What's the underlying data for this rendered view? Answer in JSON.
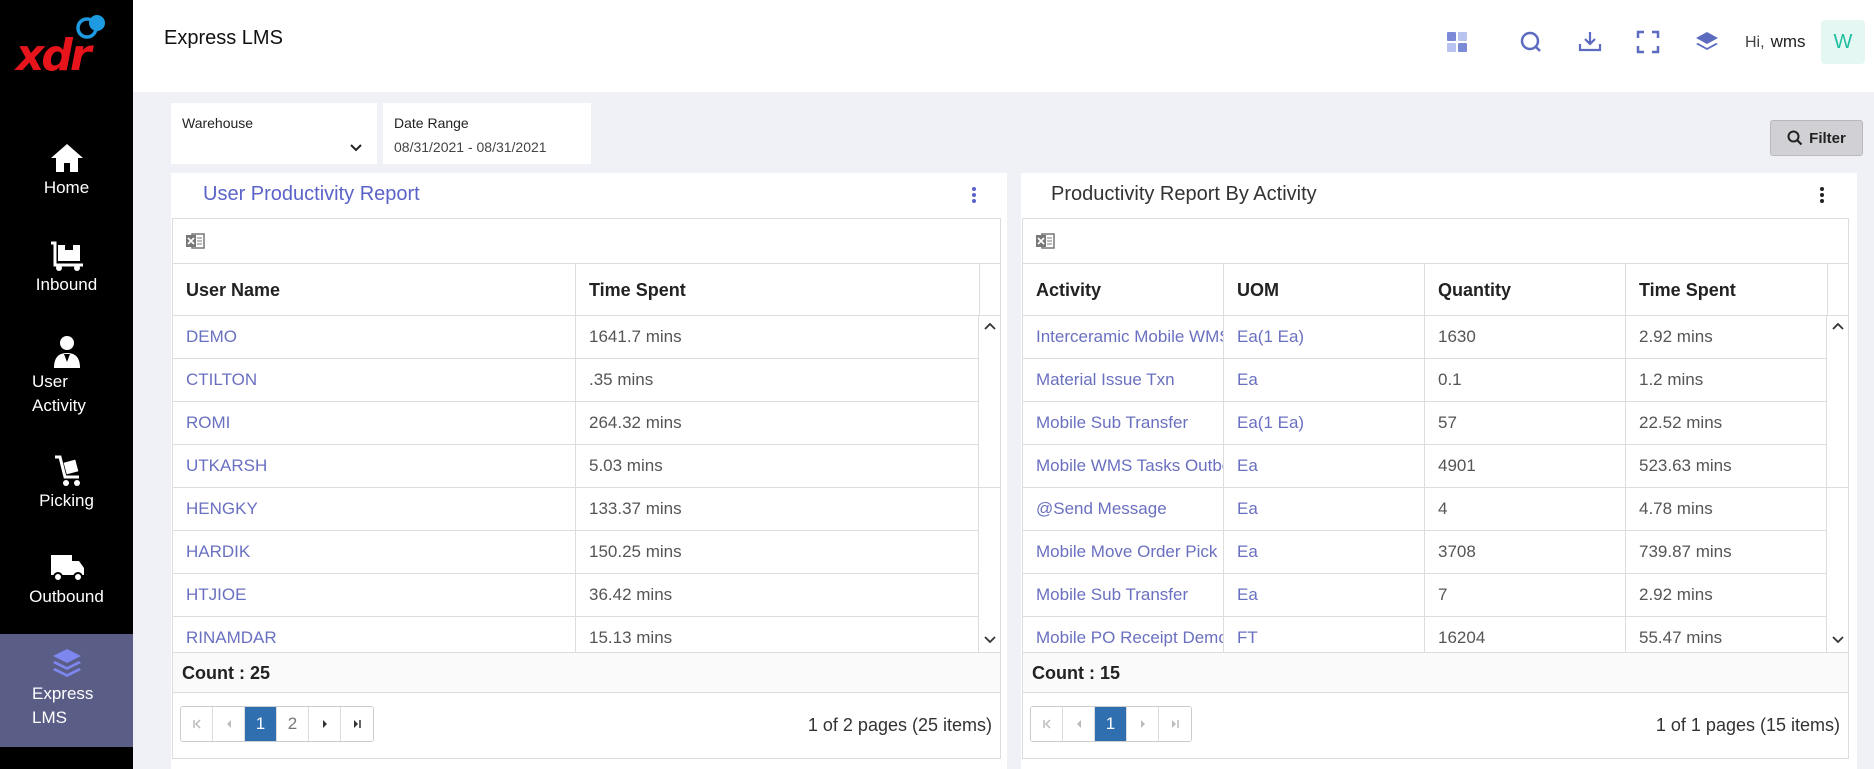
{
  "app": {
    "title": "Express LMS",
    "logo_text": "xdr"
  },
  "header": {
    "greeting": "Hi,",
    "username": "wms",
    "avatar_initial": "W",
    "icons": [
      "dashboard-grid-icon",
      "search-icon",
      "download-icon",
      "fullscreen-icon",
      "layers-icon"
    ]
  },
  "sidebar": {
    "items": [
      {
        "label": "Home",
        "icon": "home-icon"
      },
      {
        "label": "Inbound",
        "icon": "inbound-icon"
      },
      {
        "label": "User Activity",
        "label_line1": "User",
        "label_line2": "Activity",
        "icon": "user-icon"
      },
      {
        "label": "Picking",
        "icon": "picking-icon"
      },
      {
        "label": "Outbound",
        "icon": "truck-icon"
      },
      {
        "label": "Express LMS",
        "label_line1": "Express",
        "label_line2": "LMS",
        "icon": "layers-icon",
        "active": true
      }
    ]
  },
  "filters": {
    "warehouse_label": "Warehouse",
    "warehouse_value": "",
    "date_range_label": "Date Range",
    "date_range_value": "08/31/2021 - 08/31/2021",
    "filter_button": "Filter"
  },
  "user_report": {
    "title": "User Productivity Report",
    "columns": [
      "User Name",
      "Time Spent"
    ],
    "rows": [
      [
        "DEMO",
        "1641.7 mins"
      ],
      [
        "CTILTON",
        ".35 mins"
      ],
      [
        "ROMI",
        "264.32 mins"
      ],
      [
        "UTKARSH",
        "5.03 mins"
      ],
      [
        "HENGKY",
        "133.37 mins"
      ],
      [
        "HARDIK",
        "150.25 mins"
      ],
      [
        "HTJIOE",
        "36.42 mins"
      ],
      [
        "RINAMDAR",
        "15.13 mins"
      ]
    ],
    "count": "Count : 25",
    "pages": [
      "1",
      "2"
    ],
    "current_page": "1",
    "page_info": "1 of 2 pages (25 items)"
  },
  "activity_report": {
    "title": "Productivity Report By Activity",
    "columns": [
      "Activity",
      "UOM",
      "Quantity",
      "Time Spent"
    ],
    "rows": [
      [
        "Interceramic Mobile WMS",
        "Ea(1 Ea)",
        "1630",
        "2.92 mins"
      ],
      [
        "Material Issue Txn",
        "Ea",
        "0.1",
        "1.2 mins"
      ],
      [
        "Mobile Sub Transfer",
        "Ea(1 Ea)",
        "57",
        "22.52 mins"
      ],
      [
        "Mobile WMS Tasks Outbo",
        "Ea",
        "4901",
        "523.63 mins"
      ],
      [
        "@Send Message",
        "Ea",
        "4",
        "4.78 mins"
      ],
      [
        "Mobile Move Order Pick",
        "Ea",
        "3708",
        "739.87 mins"
      ],
      [
        "Mobile Sub Transfer",
        "Ea",
        "7",
        "2.92 mins"
      ],
      [
        "Mobile PO Receipt Demo",
        "FT",
        "16204",
        "55.47 mins"
      ]
    ],
    "count": "Count : 15",
    "pages": [
      "1"
    ],
    "current_page": "1",
    "page_info": "1 of 1 pages (15 items)"
  },
  "colors": {
    "sidebar_bg": "#000000",
    "sidebar_active": "#5a5e86",
    "link": "#6a70c0",
    "page_bg": "#f0f1f6",
    "pager_current": "#2f6fb0",
    "logo_red": "#e8141c"
  }
}
